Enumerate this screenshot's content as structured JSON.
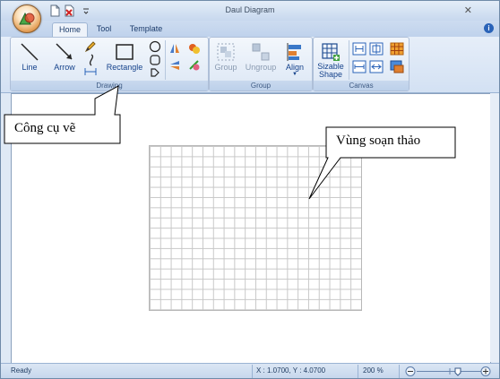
{
  "window": {
    "title": "Daul Diagram"
  },
  "tabs": [
    "Home",
    "Tool",
    "Template"
  ],
  "ribbon": {
    "drawing": {
      "label": "Drawing",
      "line": "Line",
      "arrow": "Arrow",
      "rectangle": "Rectangle"
    },
    "group": {
      "label": "Group",
      "group": "Group",
      "ungroup": "Ungroup",
      "align": "Align"
    },
    "canvas": {
      "label": "Canvas",
      "sizable_line1": "Sizable",
      "sizable_line2": "Shape"
    }
  },
  "annotations": {
    "tools": "Công cụ vẽ",
    "editor": "Vùng soạn thảo"
  },
  "status": {
    "ready": "Ready",
    "coords": "X : 1.0700, Y : 4.0700",
    "zoom": "200 %"
  },
  "colors": {
    "accent": "#15428b",
    "ribbon": "#dce7f5",
    "grid": "#c8c8c8"
  }
}
